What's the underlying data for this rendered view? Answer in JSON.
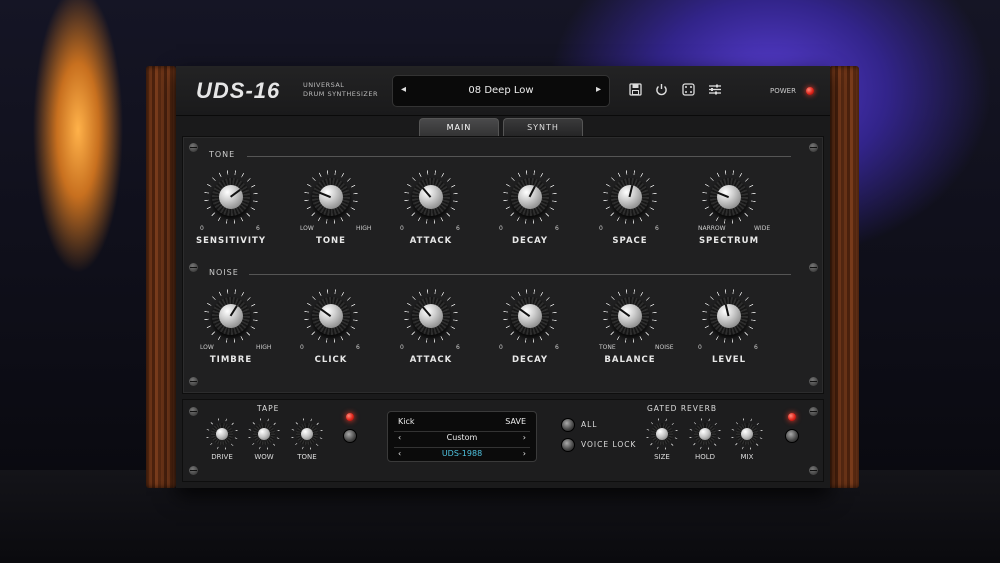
{
  "app": {
    "logo": "UDS-16",
    "subtitle_line1": "UNIVERSAL",
    "subtitle_line2": "DRUM SYNTHESIZER"
  },
  "preset_bar": {
    "name": "08 Deep Low",
    "prev": "◂",
    "next": "▸"
  },
  "toolbar": {
    "power_label": "POWER"
  },
  "tabs": [
    {
      "label": "MAIN",
      "active": true
    },
    {
      "label": "SYNTH",
      "active": false
    }
  ],
  "tone": {
    "section_label": "TONE",
    "knobs": [
      {
        "label": "SENSITIVITY",
        "min": "0",
        "max": "6",
        "value": 0.7
      },
      {
        "label": "TONE",
        "min": "LOW",
        "max": "HIGH",
        "value": 0.25
      },
      {
        "label": "ATTACK",
        "min": "0",
        "max": "6",
        "value": 0.35
      },
      {
        "label": "DECAY",
        "min": "0",
        "max": "6",
        "value": 0.6
      },
      {
        "label": "SPACE",
        "min": "0",
        "max": "6",
        "value": 0.55
      },
      {
        "label": "SPECTRUM",
        "min": "NARROW",
        "max": "WIDE",
        "value": 0.25
      }
    ]
  },
  "noise": {
    "section_label": "NOISE",
    "knobs": [
      {
        "label": "TIMBRE",
        "min": "LOW",
        "max": "HIGH",
        "value": 0.62
      },
      {
        "label": "CLICK",
        "min": "0",
        "max": "6",
        "value": 0.3
      },
      {
        "label": "ATTACK",
        "min": "0",
        "max": "6",
        "value": 0.35
      },
      {
        "label": "DECAY",
        "min": "0",
        "max": "6",
        "value": 0.3
      },
      {
        "label": "BALANCE",
        "min": "TONE",
        "max": "NOISE",
        "value": 0.3
      },
      {
        "label": "LEVEL",
        "min": "0",
        "max": "6",
        "value": 0.45
      }
    ]
  },
  "tape": {
    "label": "TAPE",
    "knobs": [
      "DRIVE",
      "WOW",
      "TONE"
    ]
  },
  "display": {
    "instrument": "Kick",
    "save": "SAVE",
    "left": "‹",
    "right": "›",
    "row2": "Custom",
    "row3": "UDS-1988"
  },
  "voice_switches": {
    "all": "ALL",
    "voice_lock": "VOICE LOCK"
  },
  "gated_reverb": {
    "label": "GATED REVERB",
    "knobs": [
      "SIZE",
      "HOLD",
      "MIX"
    ]
  },
  "colors": {
    "led": "#e0241a",
    "display_accent": "#4fc3e0"
  }
}
